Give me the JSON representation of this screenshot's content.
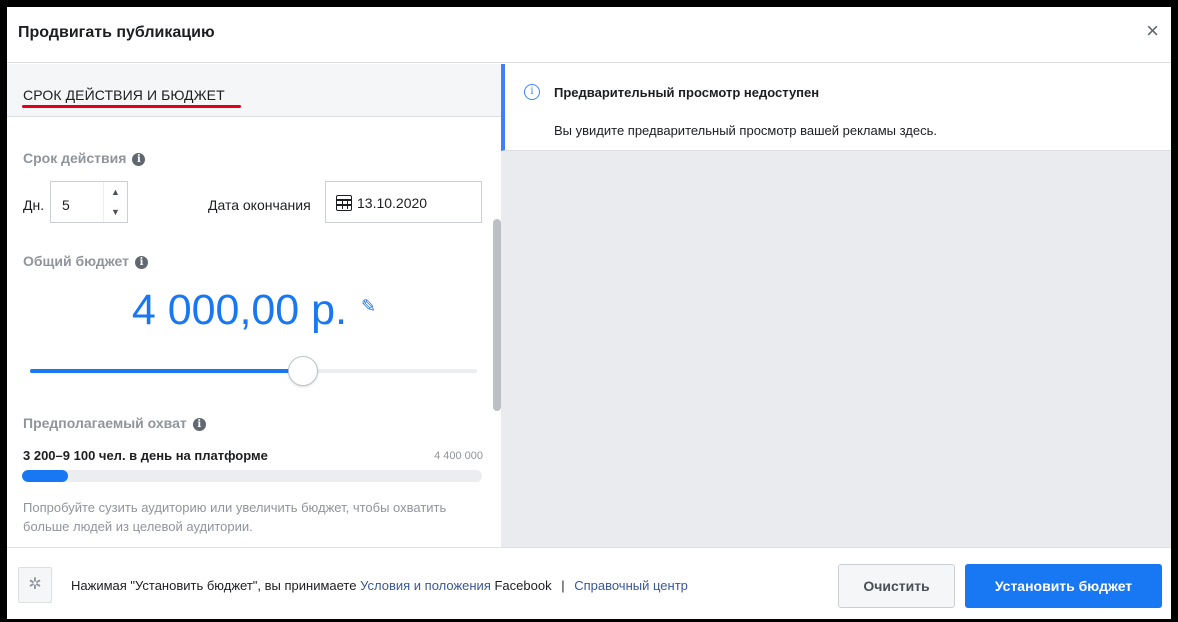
{
  "header": {
    "title": "Продвигать публикацию",
    "close_glyph": "×"
  },
  "left_panel": {
    "section_title": "СРОК ДЕЙСТВИЯ И БЮДЖЕТ",
    "duration": {
      "label": "Срок действия",
      "days_label": "Дн.",
      "days_value": "5",
      "end_date_label": "Дата окончания",
      "end_date_value": "13.10.2020"
    },
    "budget": {
      "label": "Общий бюджет",
      "amount": "4 000,00 р.",
      "slider_fraction": 0.61
    },
    "reach": {
      "label": "Предполагаемый охват",
      "text": "3 200–9 100 чел. в день на платформе",
      "max": "4 400 000",
      "bar_fraction": 0.1,
      "hint": "Попробуйте сузить аудиторию или увеличить бюджет, чтобы охватить больше людей из целевой аудитории."
    }
  },
  "preview": {
    "title": "Предварительный просмотр недоступен",
    "body": "Вы увидите предварительный просмотр вашей рекламы здесь."
  },
  "footer": {
    "terms_prefix": "Нажимая \"Установить бюджет\", вы принимаете",
    "terms_link": "Условия и положения",
    "terms_suffix": "Facebook",
    "separator": "|",
    "help_link": "Справочный центр",
    "clear_label": "Очистить",
    "set_budget_label": "Установить бюджет"
  },
  "colors": {
    "accent": "#1877f2",
    "section_underline": "#e2001a"
  },
  "icons": {
    "info": "info-icon",
    "calendar": "calendar-icon",
    "edit": "pencil-icon",
    "gear": "gear-icon",
    "close": "close-icon"
  }
}
